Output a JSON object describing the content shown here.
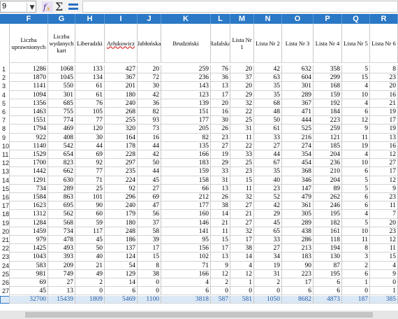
{
  "toolbar": {
    "name_box": "9",
    "name_box_arrow_icon": "chevron-down-icon",
    "function_wizard_icon": "function-wizard-icon",
    "sum_symbol": "Σ",
    "formula_icon": "formula-equals-icon",
    "formula_value": ""
  },
  "columns": [
    "F",
    "G",
    "H",
    "I",
    "J",
    "K",
    "L",
    "M",
    "N",
    "O",
    "P",
    "Q",
    "R"
  ],
  "headers": [
    "Liczba uprawnionych",
    "Liczba wydanych kart",
    "Liberadzki",
    "Arłukowicz",
    "Jabłońska",
    "Brudziński",
    "Rafalska",
    "Lista Nr 1",
    "Lista Nr 2",
    "Lista Nr 3",
    "Lista Nr 4",
    "Lista Nr 5",
    "Lista Nr 6"
  ],
  "rows": [
    [
      "1",
      "1286",
      "1068",
      "133",
      "427",
      "20",
      "259",
      "76",
      "20",
      "42",
      "632",
      "358",
      "5",
      "8"
    ],
    [
      "2",
      "1870",
      "1045",
      "134",
      "367",
      "72",
      "236",
      "36",
      "37",
      "63",
      "604",
      "299",
      "15",
      "23"
    ],
    [
      "3",
      "1141",
      "550",
      "61",
      "201",
      "30",
      "143",
      "13",
      "20",
      "35",
      "301",
      "168",
      "4",
      "20"
    ],
    [
      "4",
      "1094",
      "301",
      "61",
      "180",
      "42",
      "123",
      "17",
      "29",
      "35",
      "289",
      "159",
      "10",
      "16"
    ],
    [
      "5",
      "1356",
      "685",
      "76",
      "240",
      "36",
      "139",
      "20",
      "32",
      "68",
      "367",
      "192",
      "4",
      "21"
    ],
    [
      "6",
      "1463",
      "755",
      "105",
      "268",
      "82",
      "151",
      "16",
      "22",
      "48",
      "471",
      "184",
      "6",
      "19"
    ],
    [
      "7",
      "1551",
      "774",
      "77",
      "255",
      "93",
      "177",
      "30",
      "25",
      "50",
      "444",
      "223",
      "12",
      "17"
    ],
    [
      "8",
      "1794",
      "469",
      "120",
      "320",
      "73",
      "205",
      "26",
      "31",
      "61",
      "525",
      "259",
      "9",
      "19"
    ],
    [
      "9",
      "922",
      "408",
      "30",
      "164",
      "16",
      "82",
      "23",
      "11",
      "33",
      "216",
      "121",
      "11",
      "13"
    ],
    [
      "10",
      "1140",
      "542",
      "44",
      "178",
      "44",
      "135",
      "27",
      "22",
      "27",
      "274",
      "185",
      "19",
      "16"
    ],
    [
      "11",
      "1529",
      "654",
      "69",
      "228",
      "42",
      "166",
      "19",
      "33",
      "44",
      "354",
      "204",
      "4",
      "12"
    ],
    [
      "12",
      "1700",
      "823",
      "92",
      "297",
      "50",
      "183",
      "29",
      "25",
      "67",
      "454",
      "236",
      "10",
      "27"
    ],
    [
      "13",
      "1442",
      "662",
      "77",
      "235",
      "44",
      "159",
      "33",
      "23",
      "35",
      "368",
      "210",
      "6",
      "17"
    ],
    [
      "14",
      "1291",
      "630",
      "71",
      "224",
      "45",
      "158",
      "31",
      "15",
      "40",
      "346",
      "204",
      "5",
      "12"
    ],
    [
      "15",
      "734",
      "289",
      "25",
      "92",
      "27",
      "66",
      "13",
      "11",
      "23",
      "147",
      "89",
      "5",
      "9"
    ],
    [
      "16",
      "1584",
      "863",
      "101",
      "296",
      "69",
      "212",
      "26",
      "32",
      "52",
      "479",
      "262",
      "6",
      "23"
    ],
    [
      "17",
      "1623",
      "695",
      "90",
      "240",
      "47",
      "177",
      "38",
      "27",
      "42",
      "361",
      "246",
      "6",
      "11"
    ],
    [
      "18",
      "1312",
      "562",
      "60",
      "179",
      "56",
      "160",
      "14",
      "21",
      "29",
      "305",
      "195",
      "4",
      "7"
    ],
    [
      "19",
      "1284",
      "568",
      "59",
      "180",
      "37",
      "146",
      "21",
      "27",
      "45",
      "289",
      "182",
      "5",
      "20"
    ],
    [
      "20",
      "1459",
      "734",
      "117",
      "248",
      "58",
      "141",
      "11",
      "32",
      "65",
      "438",
      "161",
      "10",
      "23"
    ],
    [
      "21",
      "979",
      "478",
      "45",
      "186",
      "39",
      "95",
      "15",
      "17",
      "33",
      "286",
      "118",
      "11",
      "12"
    ],
    [
      "22",
      "1425",
      "493",
      "50",
      "137",
      "17",
      "156",
      "17",
      "38",
      "27",
      "213",
      "194",
      "8",
      "11"
    ],
    [
      "23",
      "1043",
      "393",
      "40",
      "124",
      "15",
      "102",
      "13",
      "14",
      "34",
      "183",
      "130",
      "3",
      "15"
    ],
    [
      "24",
      "583",
      "209",
      "21",
      "54",
      "8",
      "71",
      "9",
      "4",
      "19",
      "90",
      "87",
      "2",
      "4"
    ],
    [
      "25",
      "981",
      "749",
      "49",
      "129",
      "38",
      "166",
      "12",
      "12",
      "31",
      "223",
      "195",
      "6",
      "9"
    ],
    [
      "26",
      "69",
      "27",
      "2",
      "14",
      "0",
      "4",
      "2",
      "1",
      "2",
      "17",
      "6",
      "1",
      "0"
    ],
    [
      "27",
      "45",
      "13",
      "0",
      "6",
      "0",
      "6",
      "0",
      "0",
      "0",
      "6",
      "6",
      "0",
      "1"
    ]
  ],
  "total": [
    "32700",
    "15439",
    "1809",
    "5469",
    "1100",
    "3818",
    "587",
    "581",
    "1050",
    "8682",
    "4873",
    "187",
    "385"
  ]
}
